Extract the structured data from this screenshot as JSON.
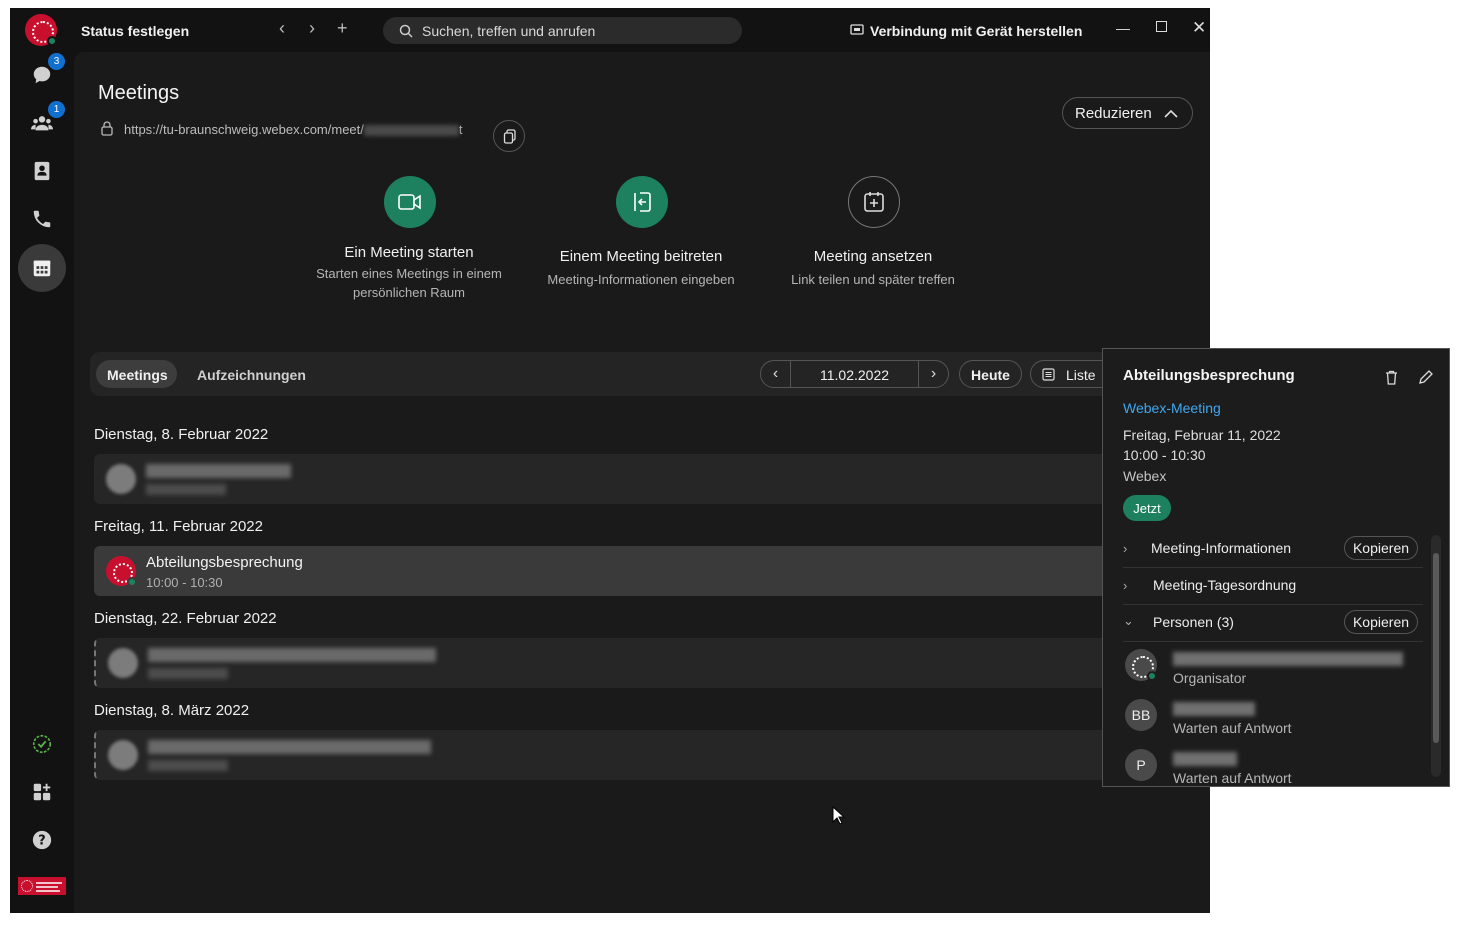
{
  "topbar": {
    "status_label": "Status festlegen",
    "search_placeholder": "Suchen, treffen und anrufen",
    "connect_label": "Verbindung mit Gerät herstellen"
  },
  "rail": {
    "messages_badge": "3",
    "teams_badge": "1"
  },
  "header": {
    "title": "Meetings",
    "url_prefix": "https://tu-braunschweig.webex.com/meet/",
    "url_suffix": "t",
    "reduce_label": "Reduzieren"
  },
  "actions": [
    {
      "title": "Ein Meeting starten",
      "subtitle": "Starten eines Meetings in einem persönlichen Raum"
    },
    {
      "title": "Einem Meeting beitreten",
      "subtitle": "Meeting-Informationen eingeben"
    },
    {
      "title": "Meeting ansetzen",
      "subtitle": "Link teilen und später treffen"
    }
  ],
  "tabs": {
    "meetings": "Meetings",
    "recordings": "Aufzeichnungen",
    "date": "11.02.2022",
    "today": "Heute",
    "list": "Liste"
  },
  "days": [
    {
      "label": "Dienstag, 8. Februar 2022"
    },
    {
      "label": "Freitag, 11. Februar 2022",
      "meeting_title": "Abteilungsbesprechung",
      "meeting_time": "10:00 - 10:30"
    },
    {
      "label": "Dienstag, 22. Februar 2022"
    },
    {
      "label": "Dienstag, 8. März 2022"
    }
  ],
  "popup": {
    "title": "Abteilungsbesprechung",
    "link": "Webex-Meeting",
    "date": "Freitag, Februar 11, 2022",
    "time": "10:00 - 10:30",
    "location": "Webex",
    "now": "Jetzt",
    "sections": [
      {
        "label": "Meeting-Informationen",
        "button": "Kopieren"
      },
      {
        "label": "Meeting-Tagesordnung"
      },
      {
        "label": "Personen (3)",
        "button": "Kopieren"
      }
    ],
    "people": [
      {
        "initials": "",
        "role": "Organisator"
      },
      {
        "initials": "BB",
        "role": "Warten auf Antwort"
      },
      {
        "initials": "P",
        "role": "Warten auf Antwort"
      }
    ]
  },
  "colors": {
    "accent_green": "#1d8160",
    "badge_blue": "#1170cf",
    "link_blue": "#3fa8f0",
    "brand_red": "#c8102e"
  }
}
